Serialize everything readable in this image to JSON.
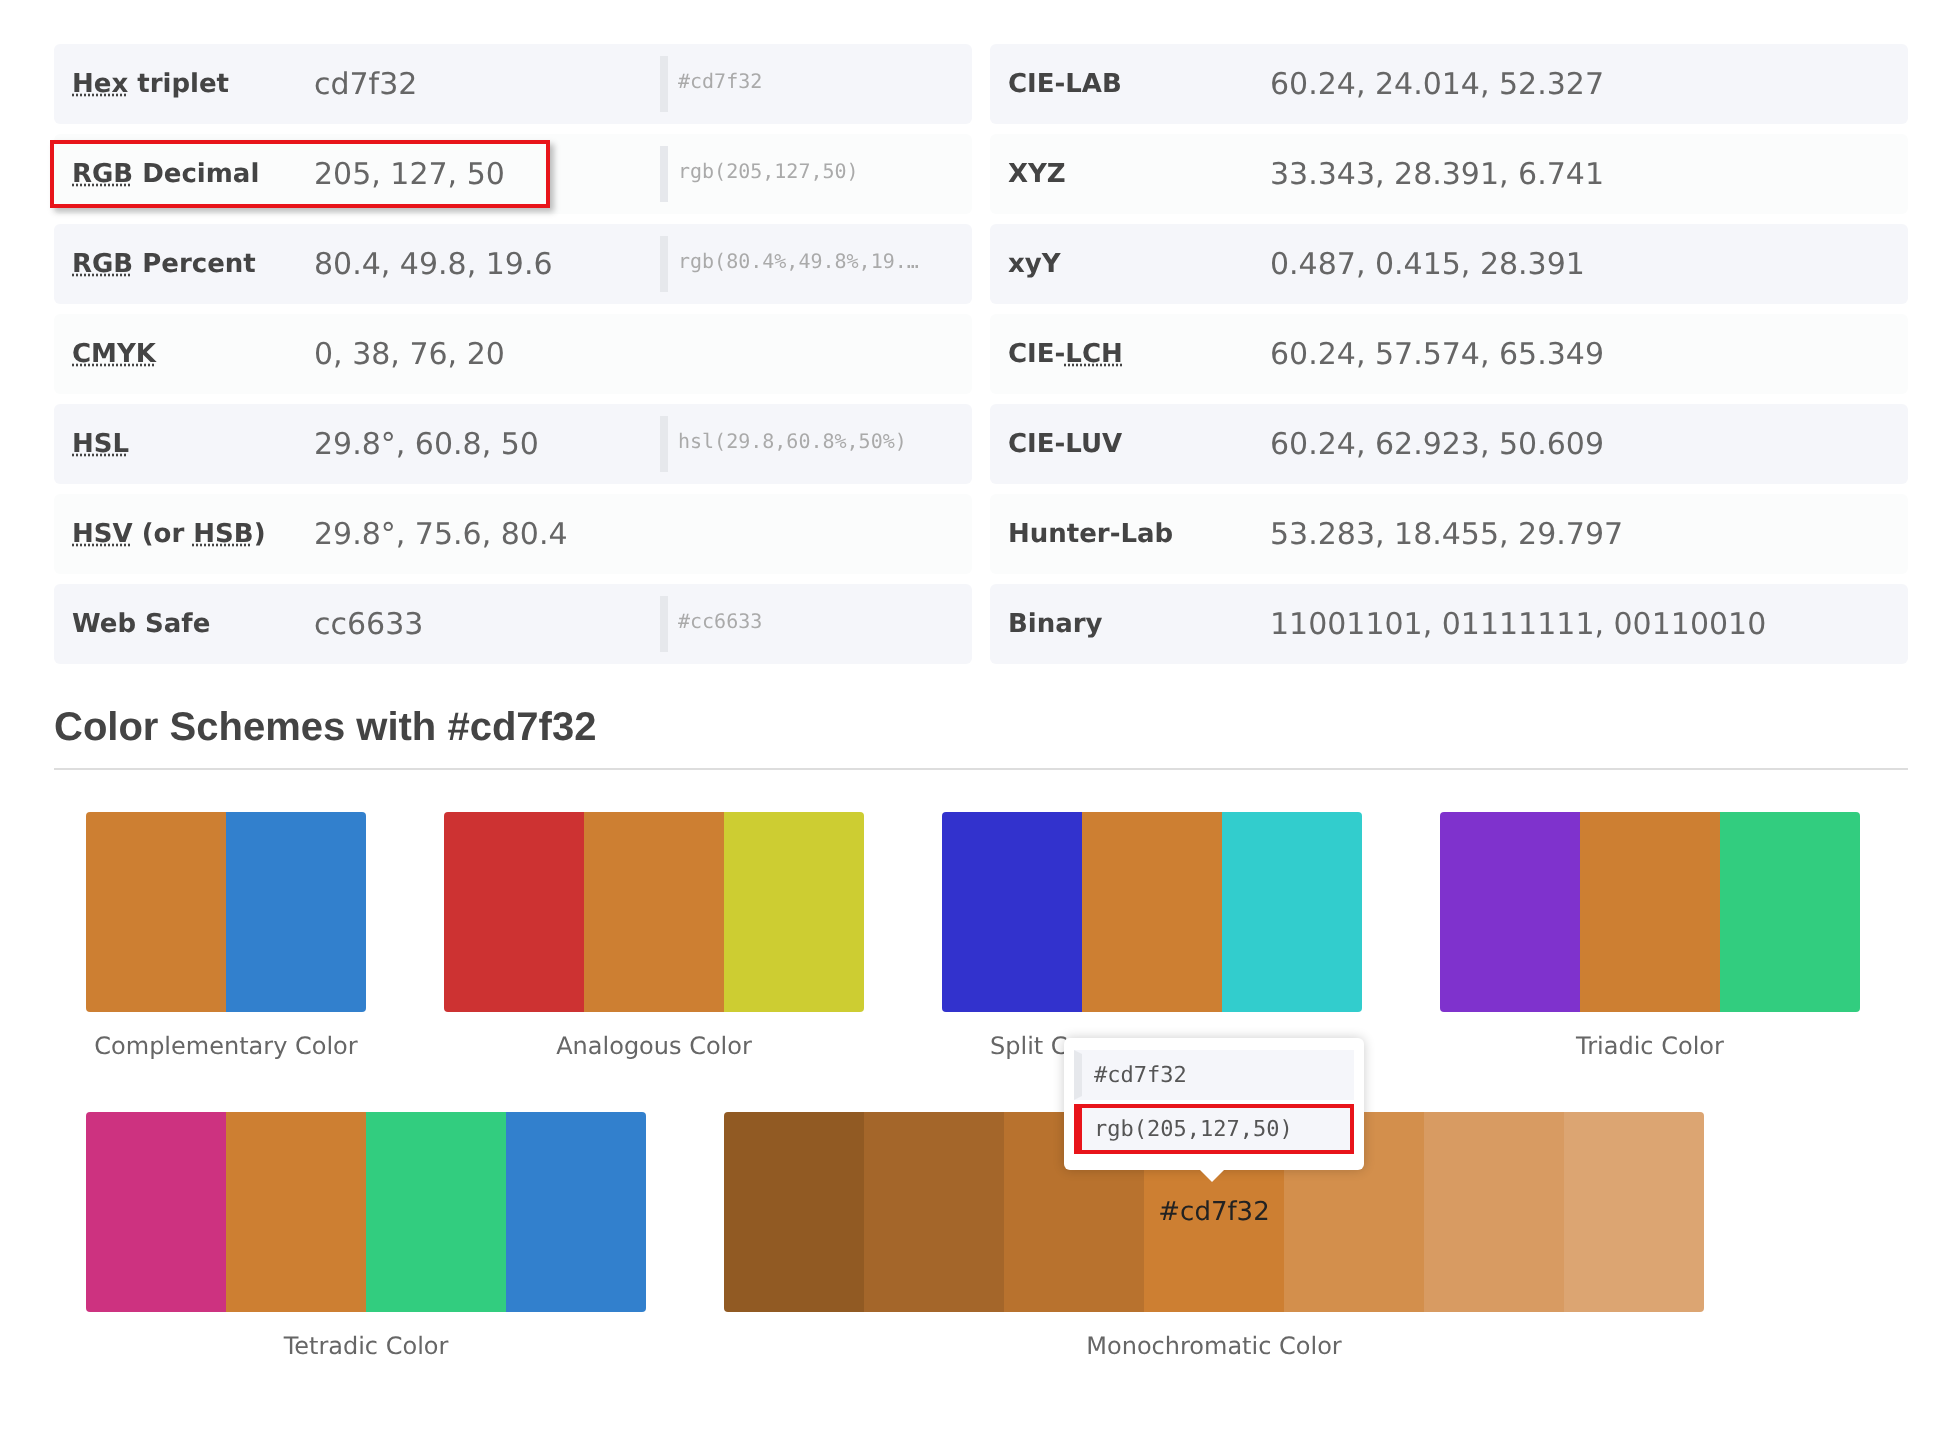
{
  "conversions_left": [
    {
      "label": "**Hex** triplet",
      "value": "cd7f32",
      "code": "#cd7f32",
      "highlighted": false
    },
    {
      "label": "**RGB** Decimal",
      "value": "205, 127, 50",
      "code": "rgb(205,127,50)",
      "highlighted": true
    },
    {
      "label": "**RGB** Percent",
      "value": "80.4, 49.8, 19.6",
      "code": "rgb(80.4%,49.8%,19.…",
      "highlighted": false
    },
    {
      "label": "**CMYK**",
      "value": "0, 38, 76, 20",
      "highlighted": false
    },
    {
      "label": "**HSL**",
      "value": "29.8°, 60.8, 50",
      "code": "hsl(29.8,60.8%,50%)",
      "highlighted": false
    },
    {
      "label": "**HSV** (or **HSB**)",
      "value": "29.8°, 75.6, 80.4",
      "highlighted": false
    },
    {
      "label": "Web Safe",
      "value": "cc6633",
      "code": "#cc6633",
      "highlighted": false
    }
  ],
  "conversions_right": [
    {
      "label": "CIE-LAB",
      "value": "60.24, 24.014, 52.327"
    },
    {
      "label": "XYZ",
      "value": "33.343, 28.391, 6.741"
    },
    {
      "label": "xyY",
      "value": "0.487, 0.415, 28.391"
    },
    {
      "label": "CIE-**LCH**",
      "value": "60.24, 57.574, 65.349"
    },
    {
      "label": "CIE-LUV",
      "value": "60.24, 62.923, 50.609"
    },
    {
      "label": "Hunter-Lab",
      "value": "53.283, 18.455, 29.797"
    },
    {
      "label": "Binary",
      "value": "11001101, 01111111, 00110010"
    }
  ],
  "schemes_heading": "Color Schemes with #cd7f32",
  "scheme_rows": [
    [
      {
        "name": "Complementary Color",
        "swatches": [
          {
            "color": "#cd7f32"
          },
          {
            "color": "#3280cd"
          }
        ]
      },
      {
        "name": "Analogous Color",
        "swatches": [
          {
            "color": "#cd3232"
          },
          {
            "color": "#cd7f32"
          },
          {
            "color": "#cdcd32"
          }
        ]
      },
      {
        "name": "Split C",
        "swatches": [
          {
            "color": "#3232cd"
          },
          {
            "color": "#cd7f32"
          },
          {
            "color": "#32cdcd"
          }
        ]
      },
      {
        "name": "Triadic Color",
        "swatches": [
          {
            "color": "#7f32cd"
          },
          {
            "color": "#cd7f32"
          },
          {
            "color": "#32cd7f"
          }
        ]
      }
    ],
    [
      {
        "name": "Tetradic Color",
        "swatches": [
          {
            "color": "#cd3280"
          },
          {
            "color": "#cd7f32"
          },
          {
            "color": "#32cd7f"
          },
          {
            "color": "#3280cd"
          }
        ]
      },
      {
        "name": "Monochromatic Color",
        "swatches": [
          {
            "color": "#915a23"
          },
          {
            "color": "#a4662a"
          },
          {
            "color": "#b8722e"
          },
          {
            "color": "#cd7f32",
            "label": "#cd7f32"
          },
          {
            "color": "#d38f4c"
          },
          {
            "color": "#d89b62"
          },
          {
            "color": "#dca572"
          }
        ],
        "tooltip": {
          "lines": [
            {
              "text": "#cd7f32",
              "highlighted": false
            },
            {
              "text": "rgb(205,127,50)",
              "highlighted": true
            }
          ]
        }
      }
    ]
  ]
}
